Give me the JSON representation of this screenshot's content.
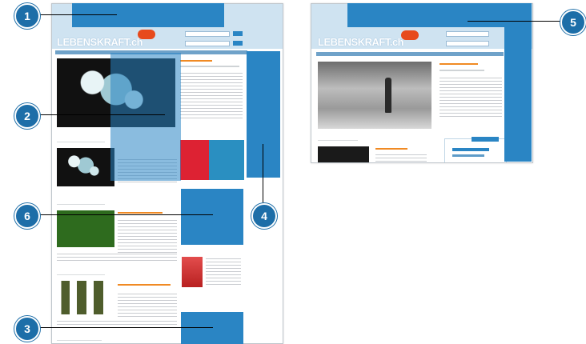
{
  "callouts": [
    {
      "number": "1"
    },
    {
      "number": "2"
    },
    {
      "number": "3"
    },
    {
      "number": "4"
    },
    {
      "number": "5"
    },
    {
      "number": "6"
    }
  ],
  "colors": {
    "highlight_blue": "#2a85c4",
    "callout_blue": "#1d6ea8",
    "brand_orange": "#f08a24"
  }
}
